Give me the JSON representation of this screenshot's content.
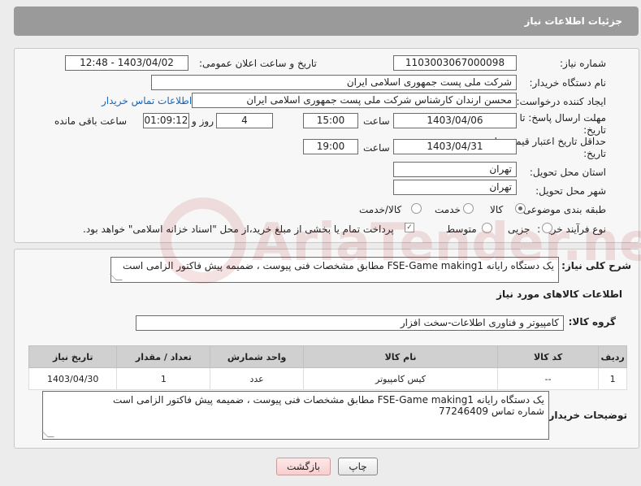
{
  "header": {
    "title": "جزئیات اطلاعات نیاز"
  },
  "form": {
    "need_number_label": "شماره نیاز:",
    "need_number": "1103003067000098",
    "announce_label": "تاریخ و ساعت اعلان عمومی:",
    "announce_value": "1403/04/02 - 12:48",
    "buyer_org_label": "نام دستگاه خریدار:",
    "buyer_org": "شرکت ملی پست جمهوری اسلامی ایران",
    "creator_label": "ایجاد کننده درخواست:",
    "creator": "محسن ارندان کارشناس شرکت ملی پست جمهوری اسلامی ایران",
    "contact_link": "اطلاعات تماس خریدار",
    "deadline_label_1": "مهلت ارسال پاسخ: تا",
    "deadline_label_2": "تاریخ:",
    "deadline_date": "1403/04/06",
    "time_label": "ساعت",
    "deadline_time": "15:00",
    "days_value": "4",
    "days_label": "روز و",
    "remaining_value": "01:09:12",
    "remaining_label": "ساعت باقی مانده",
    "validity_label_1": "حداقل تاریخ اعتبار قیمت: تا",
    "validity_label_2": "تاریخ:",
    "validity_date": "1403/04/31",
    "validity_time": "19:00",
    "province_label": "استان محل تحویل:",
    "province": "تهران",
    "city_label": "شهر محل تحویل:",
    "city": "تهران",
    "category_label": "طبقه بندی موضوعی:",
    "category_options": [
      "کالا",
      "خدمت",
      "کالا/خدمت"
    ],
    "category_selected": 0,
    "process_label": "نوع فرآیند خرید :",
    "process_options": [
      "جزیی",
      "متوسط"
    ],
    "process_note": "پرداخت تمام یا بخشی از مبلغ خرید،از محل \"اسناد خزانه اسلامی\" خواهد بود."
  },
  "description": {
    "label": "شرح کلی نیاز:",
    "text": "یک دستگاه رایانه FSE-Game making1 مطابق مشخصات فنی پیوست ، ضمیمه پیش فاکتور الزامی است"
  },
  "goods": {
    "section_title": "اطلاعات کالاهای مورد نیاز",
    "group_label": "گروه کالا:",
    "group_value": "کامپیوتر و فناوری اطلاعات-سخت افزار",
    "columns": [
      "ردیف",
      "کد کالا",
      "نام کالا",
      "واحد شمارش",
      "تعداد / مقدار",
      "تاریخ نیاز"
    ],
    "rows": [
      [
        "1",
        "--",
        "کیس کامپیوتر",
        "عدد",
        "1",
        "1403/04/30"
      ]
    ]
  },
  "buyer_notes": {
    "label": "توضیحات خریدار:",
    "line1": "یک دستگاه رایانه FSE-Game making1 مطابق مشخصات فنی پیوست ، ضمیمه پیش فاکتور الزامی است",
    "line2": "شماره تماس 77246409"
  },
  "buttons": {
    "print": "چاپ",
    "back": "بازگشت"
  },
  "watermark": {
    "text": "AriaTender.neT"
  }
}
